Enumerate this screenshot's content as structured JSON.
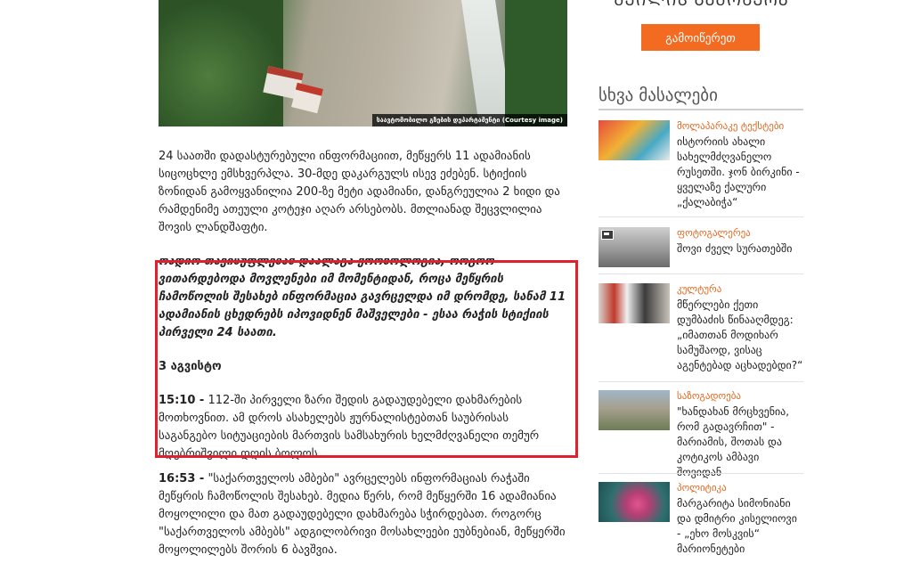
{
  "hero": {
    "caption": "საავტომობილო გზების დეპარტამენტი (Courtesy image)"
  },
  "article": {
    "paragraph1": "24 საათში დადასტურებული ინფორმაციით, მეწყერს 11 ადამიანის სიცოცხლე ემსხვერპლა. 30-მდე დაკარგულს ისევ ეძებენ. სტიქიის ზონიდან გამოყვანილია 200-ზე მეტი ადამიანი, დანგრეულია 2 ხიდი და რამდენიმე ათეული კოტეჯი აღარ არსებობს. მთლიანად შეცვლილია შოვის ლანდშაფტი.",
    "quote": "რადიო თავისუფლებამ დაალაგა ქრონოლოგია, როგორ ვითარდებოდა მოვლენები იმ მომენტიდან, როცა მეწყრის ჩამოწოლის შესახებ ინფორმაცია გავრცელდა იმ დრომდე, სანამ 11 ადამიანის ცხედრებს იპოვიდნენ მაშველები - ესაა რაჭის სტიქიის პირველი 24 საათი.",
    "date_heading": "3 აგვისტო",
    "entry1_time": "15:10 -",
    "entry1_text": " 112-ში პირველი ზარი შედის გადაუდებელი დახმარების მოთხოვნით. ამ დროს ასახელებს ჟურნალისტებთან საუბრისას საგანგებო სიტუაციების მართვის სამსახურის ხელმძღვანელი თემურ მღებრიშვილი დღის ბოლოს.",
    "entry2_time": "16:53 -",
    "entry2_text": " \"საქართველოს ამბები\" ავრცელებს ინფორმაციას რაჭაში მეწყრის ჩამოწოლის შესახებ. მედია წერს, რომ მეწყერში 16 ადამიანია მოყოლილი და მათ გადაუდებელი დახმარება სჭირდებათ. როგორც \"საქართველოს ამბებს\" ადგილობრივი მოსახლეები ეუბნებიან, მეწყერში მოყოლილებს შორის 6 ბავშვია."
  },
  "sidebar": {
    "top_title": "ᲛᲔᲘᲚᲘᲡ ᲒᲐᲛᲝᲬᲔᲠᲐ",
    "subscribe_label": "გამოიწერეთ",
    "other_title": "სხვა მასალები",
    "items": [
      {
        "category": "მოლაპარაკე ტექსტები",
        "title": "ისტორიის ახალი სახელმძღვანელო რუსეთში. ჯონ ბირკინი - ყველაზე ქალური „ქალაბიჭა“"
      },
      {
        "category": "ფოტოგალერეა",
        "title": "შოვი ძველ სურათებში"
      },
      {
        "category": "კულტურა",
        "title": "მწერლები ქეთი დუმბაძის წინააღმდეგ: „იმათთან მოდიხარ სამუშაოდ, ვისაც აგენტებად აცხადებდი?“"
      },
      {
        "category": "საზოგადოება",
        "title": "\"ხანდახან მრცხვენია, რომ გადავრჩით\" - მარიამის, შოთას და კოტიკოს ამბავი შოვიდან"
      },
      {
        "category": "პოლიტიკა",
        "title": "მარგარიტა სიმონიანი და დმიტრი კისელიოვი - „ეხო მოსკვის“ მარიონეტები"
      }
    ]
  }
}
